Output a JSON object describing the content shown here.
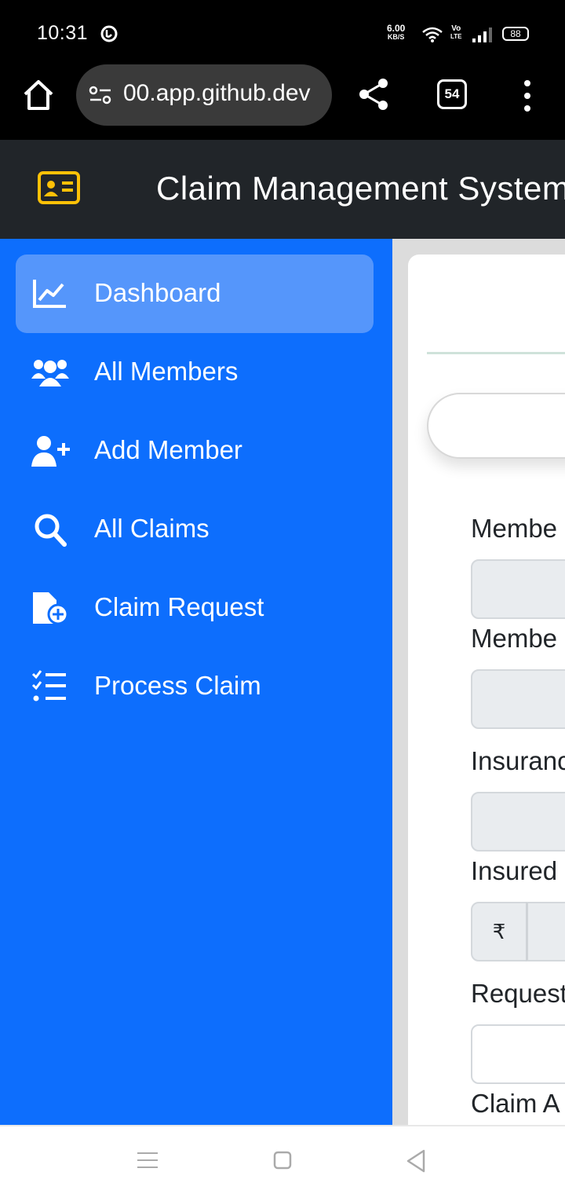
{
  "status_bar": {
    "time": "10:31",
    "speed_value": "6.00",
    "speed_unit": "KB/S",
    "volte_top": "Vo",
    "volte_bottom": "LTE",
    "battery": "88"
  },
  "browser": {
    "url": "00.app.github.dev",
    "tab_count": "54"
  },
  "header": {
    "title": "Claim Management System",
    "brand_icon_color": "#ffc107"
  },
  "sidebar": {
    "background": "#0d6efd",
    "items": [
      {
        "label": "Dashboard",
        "icon": "chart-line-icon",
        "active": true
      },
      {
        "label": "All Members",
        "icon": "users-icon"
      },
      {
        "label": "Add Member",
        "icon": "user-plus-icon"
      },
      {
        "label": "All Claims",
        "icon": "search-icon"
      },
      {
        "label": "Claim Request",
        "icon": "file-circle-plus-icon"
      },
      {
        "label": "Process Claim",
        "icon": "list-check-icon"
      }
    ]
  },
  "form": {
    "labels": [
      "Membe",
      "Membe",
      "Insuranc",
      "Insured",
      "Request",
      "Claim A"
    ],
    "currency_symbol": "₹"
  }
}
